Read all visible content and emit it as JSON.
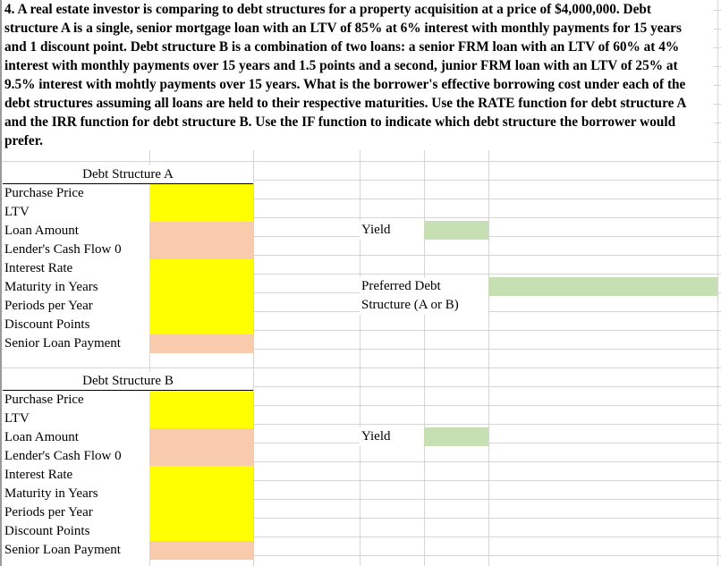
{
  "problem": {
    "lines": [
      "4.  A real estate investor is comparing to debt structures for a property acquisition at a price of $4,000,000.  Debt",
      "structure A is a single, senior mortgage loan with an LTV of 85% at 6% interest with monthly payments for 15 years",
      "and 1 discount point.  Debt structure B is a combination of two loans:  a senior FRM loan with an LTV of 60% at 4%",
      "interest with monthly payments over 15 years and 1.5 points and a second, junior FRM loan with an LTV of 25% at",
      "9.5% interest with mohtly payments over 15 years.  What is the borrower's effective borrowing cost under each of the",
      "debt structures assuming all loans are held to their respective maturities.  Use the RATE function for debt structure A",
      "and the IRR function for debt structure B.  Use the IF function to indicate which debt structure the borrower would",
      "prefer."
    ]
  },
  "structure_a": {
    "title": "Debt Structure A",
    "rows": [
      {
        "label": "Purchase Price",
        "value": "",
        "fill": "yellow"
      },
      {
        "label": "LTV",
        "value": "",
        "fill": "yellow"
      },
      {
        "label": "Loan Amount",
        "value": "",
        "fill": "peach"
      },
      {
        "label": "Lender's Cash Flow 0",
        "value": "",
        "fill": "peach"
      },
      {
        "label": "Interest Rate",
        "value": "",
        "fill": "yellow"
      },
      {
        "label": "Maturity in Years",
        "value": "",
        "fill": "yellow"
      },
      {
        "label": "Periods per Year",
        "value": "",
        "fill": "yellow"
      },
      {
        "label": "Discount Points",
        "value": "",
        "fill": "yellow"
      },
      {
        "label": "Senior Loan Payment",
        "value": "",
        "fill": "peach"
      }
    ],
    "yield_label": "Yield",
    "yield_value": ""
  },
  "preferred": {
    "label_line1": "Preferred Debt",
    "label_line2": "Structure (A or B)",
    "value": ""
  },
  "structure_b": {
    "title": "Debt Structure B",
    "rows": [
      {
        "label": "Purchase Price",
        "value": "",
        "fill": "yellow"
      },
      {
        "label": "LTV",
        "value": "",
        "fill": "yellow"
      },
      {
        "label": "Loan Amount",
        "value": "",
        "fill": "peach"
      },
      {
        "label": "Lender's Cash Flow 0",
        "value": "",
        "fill": "peach"
      },
      {
        "label": "Interest Rate",
        "value": "",
        "fill": "yellow"
      },
      {
        "label": "Maturity in Years",
        "value": "",
        "fill": "yellow"
      },
      {
        "label": "Periods per Year",
        "value": "",
        "fill": "yellow"
      },
      {
        "label": "Discount Points",
        "value": "",
        "fill": "yellow"
      },
      {
        "label": "Senior Loan Payment",
        "value": "",
        "fill": "peach"
      }
    ],
    "yield_label": "Yield",
    "yield_value": ""
  },
  "colors": {
    "input_yellow": "#ffff00",
    "formula_peach": "#f8cbad",
    "output_green": "#c6e0b4",
    "gridline": "#d4d4d4"
  }
}
